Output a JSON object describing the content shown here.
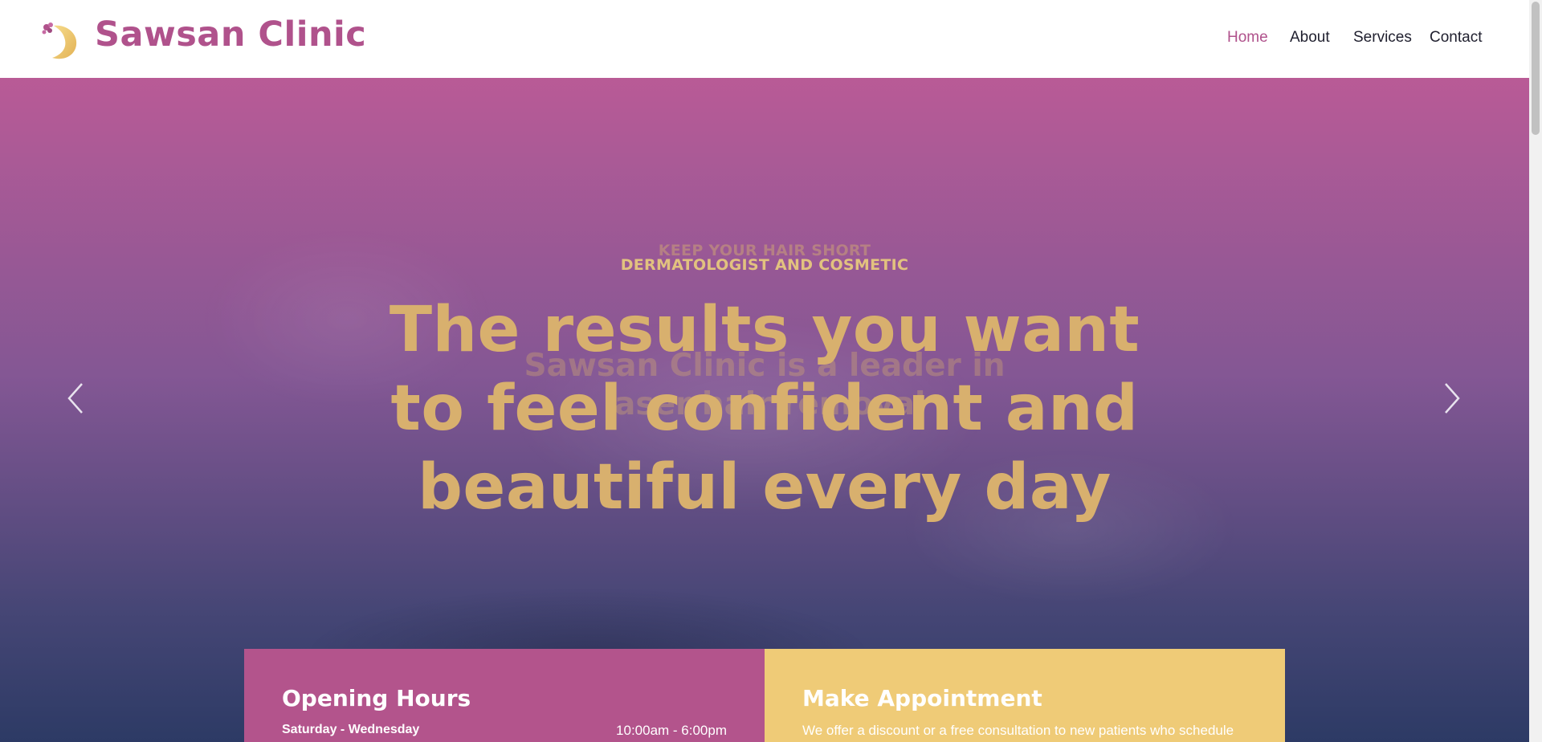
{
  "header": {
    "brand": "Sawsan Clinic",
    "logo_icon": "woman-silhouette-moon-logo",
    "nav": [
      {
        "label": "Home",
        "active": true
      },
      {
        "label": "About",
        "active": false
      },
      {
        "label": "Services",
        "active": false
      },
      {
        "label": "Contact",
        "active": false
      }
    ]
  },
  "hero": {
    "kicker_ghost": "KEEP YOUR HAIR SHORT",
    "kicker": "DERMATOLOGIST AND COSMETIC",
    "ghost_title": "Sawsan Clinic is a leader in laser hair removal",
    "title": "The results you want to feel confident and beautiful every day",
    "prev_icon": "chevron-left-icon",
    "next_icon": "chevron-right-icon"
  },
  "cards": {
    "hours": {
      "title": "Opening Hours",
      "rows": [
        {
          "day": "Saturday - Wednesday",
          "time": "10:00am - 6:00pm"
        }
      ]
    },
    "appointment": {
      "title": "Make Appointment",
      "text": "We offer a discount or a free consultation to new patients who schedule"
    }
  },
  "colors": {
    "brand": "#b0528c",
    "gold": "#d8b06e",
    "appointment_bg": "#efcb77",
    "hours_bg": "#b3548c"
  }
}
